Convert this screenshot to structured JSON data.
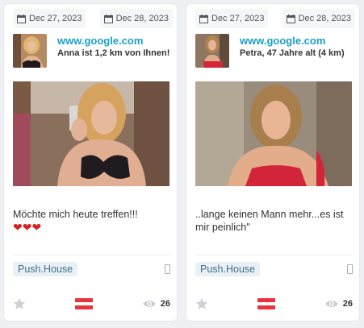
{
  "cards": [
    {
      "date_start": "Dec 27, 2023",
      "date_end": "Dec 28, 2023",
      "site": "www.google.com",
      "name": "Anna ist 1,2 km von Ihnen!",
      "message": "Möchte mich heute treffen!!!",
      "hearts": "❤❤❤",
      "tag": "Push.House",
      "views": "26",
      "flag_colors": [
        "#e8343c",
        "#ffffff",
        "#e8343c"
      ],
      "icons": {
        "calendar": "calendar-icon",
        "device": "mobile-device-icon",
        "star": "star-icon",
        "eye": "eye-icon"
      }
    },
    {
      "date_start": "Dec 27, 2023",
      "date_end": "Dec 28, 2023",
      "site": "www.google.com",
      "name": "Petra, 47 Jahre alt (4 km)",
      "message": "..lange keinen Mann mehr...es ist mir peinlich\"",
      "hearts": "",
      "tag": "Push.House",
      "views": "26",
      "flag_colors": [
        "#e8343c",
        "#ffffff",
        "#e8343c"
      ],
      "icons": {
        "calendar": "calendar-icon",
        "device": "mobile-device-icon",
        "star": "star-icon",
        "eye": "eye-icon"
      }
    }
  ],
  "colors": {
    "link": "#1a9fc9",
    "heart": "#d62020",
    "tag_bg": "#e9f1f6",
    "tag_text": "#3f6f8a"
  }
}
